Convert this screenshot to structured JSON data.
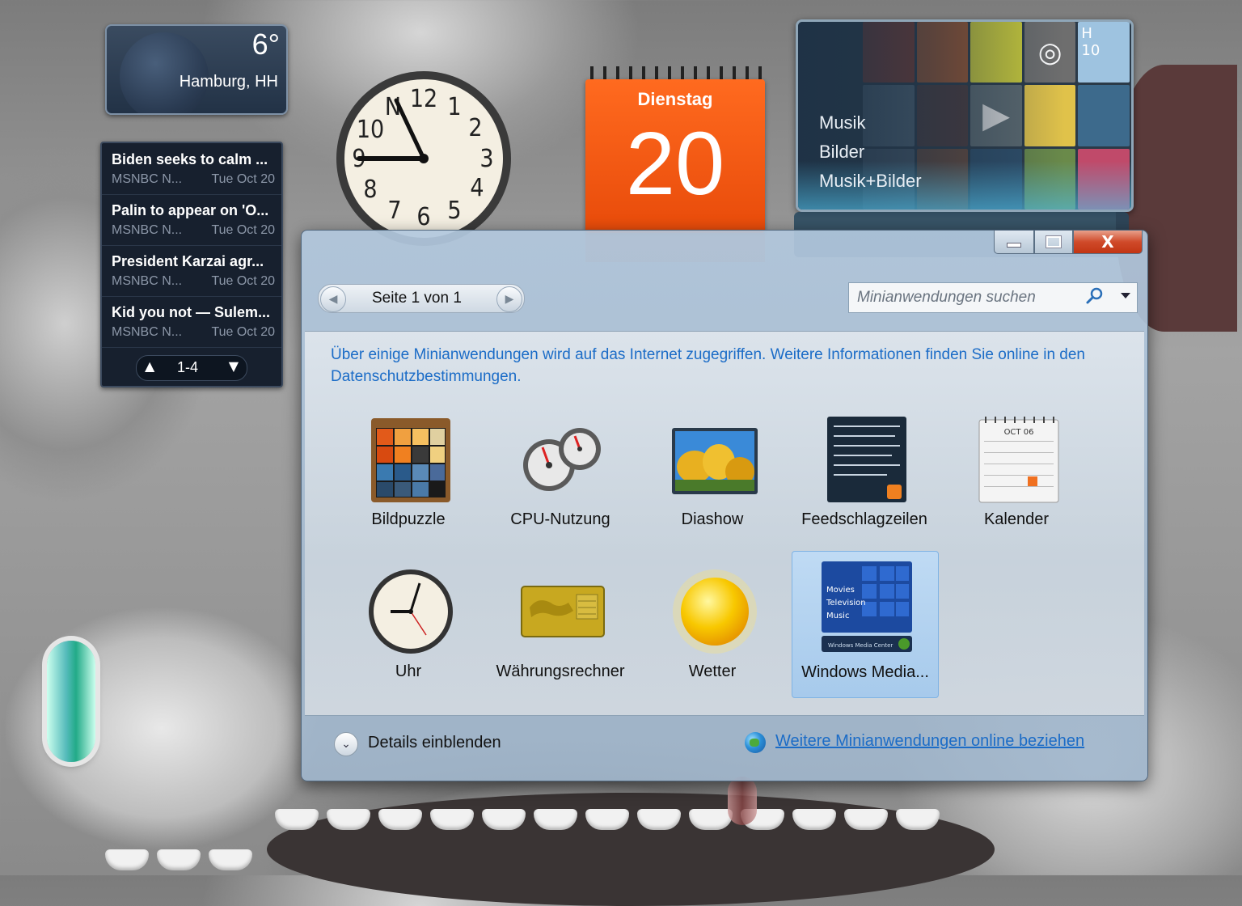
{
  "weather": {
    "temperature": "6°",
    "city": "Hamburg, HH"
  },
  "feed": {
    "items": [
      {
        "title": "Biden seeks to calm ...",
        "source": "MSNBC N...",
        "date": "Tue Oct 20"
      },
      {
        "title": "Palin to appear on 'O...",
        "source": "MSNBC N...",
        "date": "Tue Oct 20"
      },
      {
        "title": "President Karzai agr...",
        "source": "MSNBC N...",
        "date": "Tue Oct 20"
      },
      {
        "title": "Kid you not — Sulem...",
        "source": "MSNBC N...",
        "date": "Tue Oct 20"
      }
    ],
    "range": "1-4"
  },
  "calendar": {
    "weekday": "Dienstag",
    "day": "20"
  },
  "media_center": {
    "labels": [
      "Musik",
      "Bilder",
      "Musik+Bilder"
    ],
    "tile_labels": [
      "H",
      "10"
    ]
  },
  "gallery": {
    "pager": "Seite 1 von 1",
    "search_placeholder": "Minianwendungen suchen",
    "info_text": "Über einige Minianwendungen wird auf das Internet zugegriffen. Weitere Informationen finden Sie online in den Datenschutzbestimmungen.",
    "gadgets": [
      {
        "label": "Bildpuzzle",
        "icon": "picture-puzzle-icon"
      },
      {
        "label": "CPU-Nutzung",
        "icon": "cpu-meter-icon"
      },
      {
        "label": "Diashow",
        "icon": "slideshow-icon"
      },
      {
        "label": "Feedschlagzeilen",
        "icon": "feed-headlines-icon"
      },
      {
        "label": "Kalender",
        "icon": "calendar-icon"
      },
      {
        "label": "Uhr",
        "icon": "clock-icon"
      },
      {
        "label": "Währungsrechner",
        "icon": "currency-icon"
      },
      {
        "label": "Wetter",
        "icon": "weather-sun-icon"
      },
      {
        "label": "Windows Media...",
        "icon": "media-center-icon",
        "selected": true
      }
    ],
    "media_icon_lines": [
      "Movies",
      "Television",
      "Music",
      "Windows Media Center"
    ],
    "calendar_icon_month": "OCT 06",
    "details_label": "Details einblenden",
    "online_link": "Weitere Minianwendungen online beziehen",
    "window_buttons": {
      "close": "X"
    }
  },
  "colors": {
    "link_blue": "#1b6cc7",
    "calendar_orange": "#ff6a1f",
    "close_red": "#c23513"
  }
}
